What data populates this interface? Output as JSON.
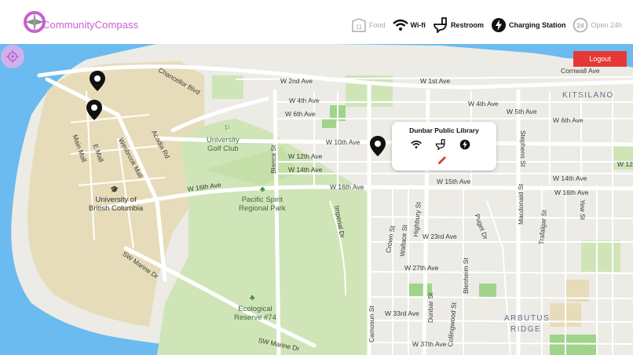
{
  "app": {
    "name": "CommunityCompass"
  },
  "filters": [
    {
      "id": "food",
      "label": "Food",
      "active": false,
      "icon": "food-icon"
    },
    {
      "id": "wifi",
      "label": "Wi-fi",
      "active": true,
      "icon": "wifi-icon"
    },
    {
      "id": "restroom",
      "label": "Restroom",
      "active": true,
      "icon": "toilet-icon"
    },
    {
      "id": "charging",
      "label": "Charging Station",
      "active": true,
      "icon": "bolt-icon"
    },
    {
      "id": "open24",
      "label": "Open 24h",
      "active": false,
      "icon": "clock-24-icon"
    }
  ],
  "logout_label": "Logout",
  "popup": {
    "title": "Dunbar Public Library",
    "amenities": [
      "wifi-icon",
      "toilet-icon",
      "bolt-icon"
    ],
    "edit_icon": "pencil-icon"
  },
  "map": {
    "areas": {
      "kitsilano": "KITSILANO",
      "arbutus": "ARBUTUS",
      "ridge": "RIDGE"
    },
    "places": {
      "golf": "University\nGolf Club",
      "pacific": "Pacific Spirit\nRegional Park",
      "ubc": "University of\nBritish Columbia",
      "ecological": "Ecological\nReserve #74"
    },
    "streets": {
      "chancellor": "Chancellor Blvd",
      "w2nd": "W 2nd Ave",
      "w1st": "W 1st Ave",
      "cornwall": "Cornwall Ave",
      "w4th": "W 4th Ave",
      "w4th_e": "W 4th Ave",
      "w5th": "W 5th Ave",
      "w6th": "W 6th Ave",
      "w6th_e": "W 6th Ave",
      "w10th": "W 10th Ave",
      "w12th": "W 12th Ave",
      "w12_e": "W 12",
      "w14th": "W 14th Ave",
      "w14th_e": "W 14th Ave",
      "w15th": "W 15th Ave",
      "w16th_w": "W 16th Ave",
      "w16th": "W 16th Ave",
      "w16th_e": "W 16th Ave",
      "w23rd": "W 23rd Ave",
      "w27th": "W 27th Ave",
      "w33rd": "W 33rd Ave",
      "w37th": "W 37th Ave",
      "sw_marine": "SW Marine Dr",
      "sw_marine2": "SW Marine Dr",
      "wesbrook": "Wesbrook Mall",
      "acadia": "Acadia Rd",
      "main_mall": "Main Mall",
      "e_mall": "E Mall",
      "blanca": "Blanca St",
      "imperial": "Imperial Dr",
      "crown": "Crown St",
      "wallace": "Wallace St",
      "highbury": "Highbury St",
      "dunbar": "Dunbar St",
      "blenheim": "Blenheim St",
      "collingwood": "Collingwood St",
      "camosun": "Camosun St",
      "puget": "Puget Dr",
      "macdonald": "Macdonald St",
      "trafalgar": "Trafalgar St",
      "stephens": "Stephens St",
      "yew": "Yew St"
    }
  }
}
